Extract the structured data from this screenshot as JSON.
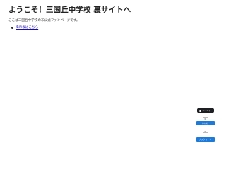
{
  "header": {
    "title": "ようこそ！三国丘中学校 裏サイトへ"
  },
  "main": {
    "intro": "ここは三国丘中学校の非公式ファンページです。",
    "links": [
      {
        "label": "掲示板はこちら"
      }
    ]
  },
  "share": {
    "tweet_label": "ツイート",
    "hatena_count": "0",
    "hatena_label": "いいね",
    "pocket_count": "0",
    "pocket_label": "ブックマーク"
  },
  "colors": {
    "link": "#1a0dab",
    "button_blue": "#1e7ad8",
    "tweet_dark": "#1d1f23"
  }
}
